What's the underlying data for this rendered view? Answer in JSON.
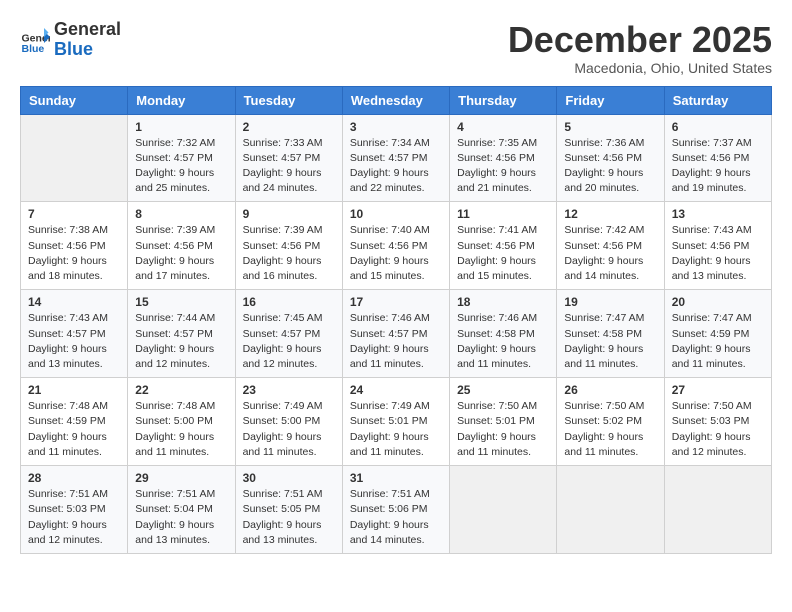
{
  "header": {
    "logo_general": "General",
    "logo_blue": "Blue",
    "month_title": "December 2025",
    "location": "Macedonia, Ohio, United States"
  },
  "days_of_week": [
    "Sunday",
    "Monday",
    "Tuesday",
    "Wednesday",
    "Thursday",
    "Friday",
    "Saturday"
  ],
  "weeks": [
    [
      {
        "day": "",
        "info": ""
      },
      {
        "day": "1",
        "info": "Sunrise: 7:32 AM\nSunset: 4:57 PM\nDaylight: 9 hours\nand 25 minutes."
      },
      {
        "day": "2",
        "info": "Sunrise: 7:33 AM\nSunset: 4:57 PM\nDaylight: 9 hours\nand 24 minutes."
      },
      {
        "day": "3",
        "info": "Sunrise: 7:34 AM\nSunset: 4:57 PM\nDaylight: 9 hours\nand 22 minutes."
      },
      {
        "day": "4",
        "info": "Sunrise: 7:35 AM\nSunset: 4:56 PM\nDaylight: 9 hours\nand 21 minutes."
      },
      {
        "day": "5",
        "info": "Sunrise: 7:36 AM\nSunset: 4:56 PM\nDaylight: 9 hours\nand 20 minutes."
      },
      {
        "day": "6",
        "info": "Sunrise: 7:37 AM\nSunset: 4:56 PM\nDaylight: 9 hours\nand 19 minutes."
      }
    ],
    [
      {
        "day": "7",
        "info": "Sunrise: 7:38 AM\nSunset: 4:56 PM\nDaylight: 9 hours\nand 18 minutes."
      },
      {
        "day": "8",
        "info": "Sunrise: 7:39 AM\nSunset: 4:56 PM\nDaylight: 9 hours\nand 17 minutes."
      },
      {
        "day": "9",
        "info": "Sunrise: 7:39 AM\nSunset: 4:56 PM\nDaylight: 9 hours\nand 16 minutes."
      },
      {
        "day": "10",
        "info": "Sunrise: 7:40 AM\nSunset: 4:56 PM\nDaylight: 9 hours\nand 15 minutes."
      },
      {
        "day": "11",
        "info": "Sunrise: 7:41 AM\nSunset: 4:56 PM\nDaylight: 9 hours\nand 15 minutes."
      },
      {
        "day": "12",
        "info": "Sunrise: 7:42 AM\nSunset: 4:56 PM\nDaylight: 9 hours\nand 14 minutes."
      },
      {
        "day": "13",
        "info": "Sunrise: 7:43 AM\nSunset: 4:56 PM\nDaylight: 9 hours\nand 13 minutes."
      }
    ],
    [
      {
        "day": "14",
        "info": "Sunrise: 7:43 AM\nSunset: 4:57 PM\nDaylight: 9 hours\nand 13 minutes."
      },
      {
        "day": "15",
        "info": "Sunrise: 7:44 AM\nSunset: 4:57 PM\nDaylight: 9 hours\nand 12 minutes."
      },
      {
        "day": "16",
        "info": "Sunrise: 7:45 AM\nSunset: 4:57 PM\nDaylight: 9 hours\nand 12 minutes."
      },
      {
        "day": "17",
        "info": "Sunrise: 7:46 AM\nSunset: 4:57 PM\nDaylight: 9 hours\nand 11 minutes."
      },
      {
        "day": "18",
        "info": "Sunrise: 7:46 AM\nSunset: 4:58 PM\nDaylight: 9 hours\nand 11 minutes."
      },
      {
        "day": "19",
        "info": "Sunrise: 7:47 AM\nSunset: 4:58 PM\nDaylight: 9 hours\nand 11 minutes."
      },
      {
        "day": "20",
        "info": "Sunrise: 7:47 AM\nSunset: 4:59 PM\nDaylight: 9 hours\nand 11 minutes."
      }
    ],
    [
      {
        "day": "21",
        "info": "Sunrise: 7:48 AM\nSunset: 4:59 PM\nDaylight: 9 hours\nand 11 minutes."
      },
      {
        "day": "22",
        "info": "Sunrise: 7:48 AM\nSunset: 5:00 PM\nDaylight: 9 hours\nand 11 minutes."
      },
      {
        "day": "23",
        "info": "Sunrise: 7:49 AM\nSunset: 5:00 PM\nDaylight: 9 hours\nand 11 minutes."
      },
      {
        "day": "24",
        "info": "Sunrise: 7:49 AM\nSunset: 5:01 PM\nDaylight: 9 hours\nand 11 minutes."
      },
      {
        "day": "25",
        "info": "Sunrise: 7:50 AM\nSunset: 5:01 PM\nDaylight: 9 hours\nand 11 minutes."
      },
      {
        "day": "26",
        "info": "Sunrise: 7:50 AM\nSunset: 5:02 PM\nDaylight: 9 hours\nand 11 minutes."
      },
      {
        "day": "27",
        "info": "Sunrise: 7:50 AM\nSunset: 5:03 PM\nDaylight: 9 hours\nand 12 minutes."
      }
    ],
    [
      {
        "day": "28",
        "info": "Sunrise: 7:51 AM\nSunset: 5:03 PM\nDaylight: 9 hours\nand 12 minutes."
      },
      {
        "day": "29",
        "info": "Sunrise: 7:51 AM\nSunset: 5:04 PM\nDaylight: 9 hours\nand 13 minutes."
      },
      {
        "day": "30",
        "info": "Sunrise: 7:51 AM\nSunset: 5:05 PM\nDaylight: 9 hours\nand 13 minutes."
      },
      {
        "day": "31",
        "info": "Sunrise: 7:51 AM\nSunset: 5:06 PM\nDaylight: 9 hours\nand 14 minutes."
      },
      {
        "day": "",
        "info": ""
      },
      {
        "day": "",
        "info": ""
      },
      {
        "day": "",
        "info": ""
      }
    ]
  ]
}
